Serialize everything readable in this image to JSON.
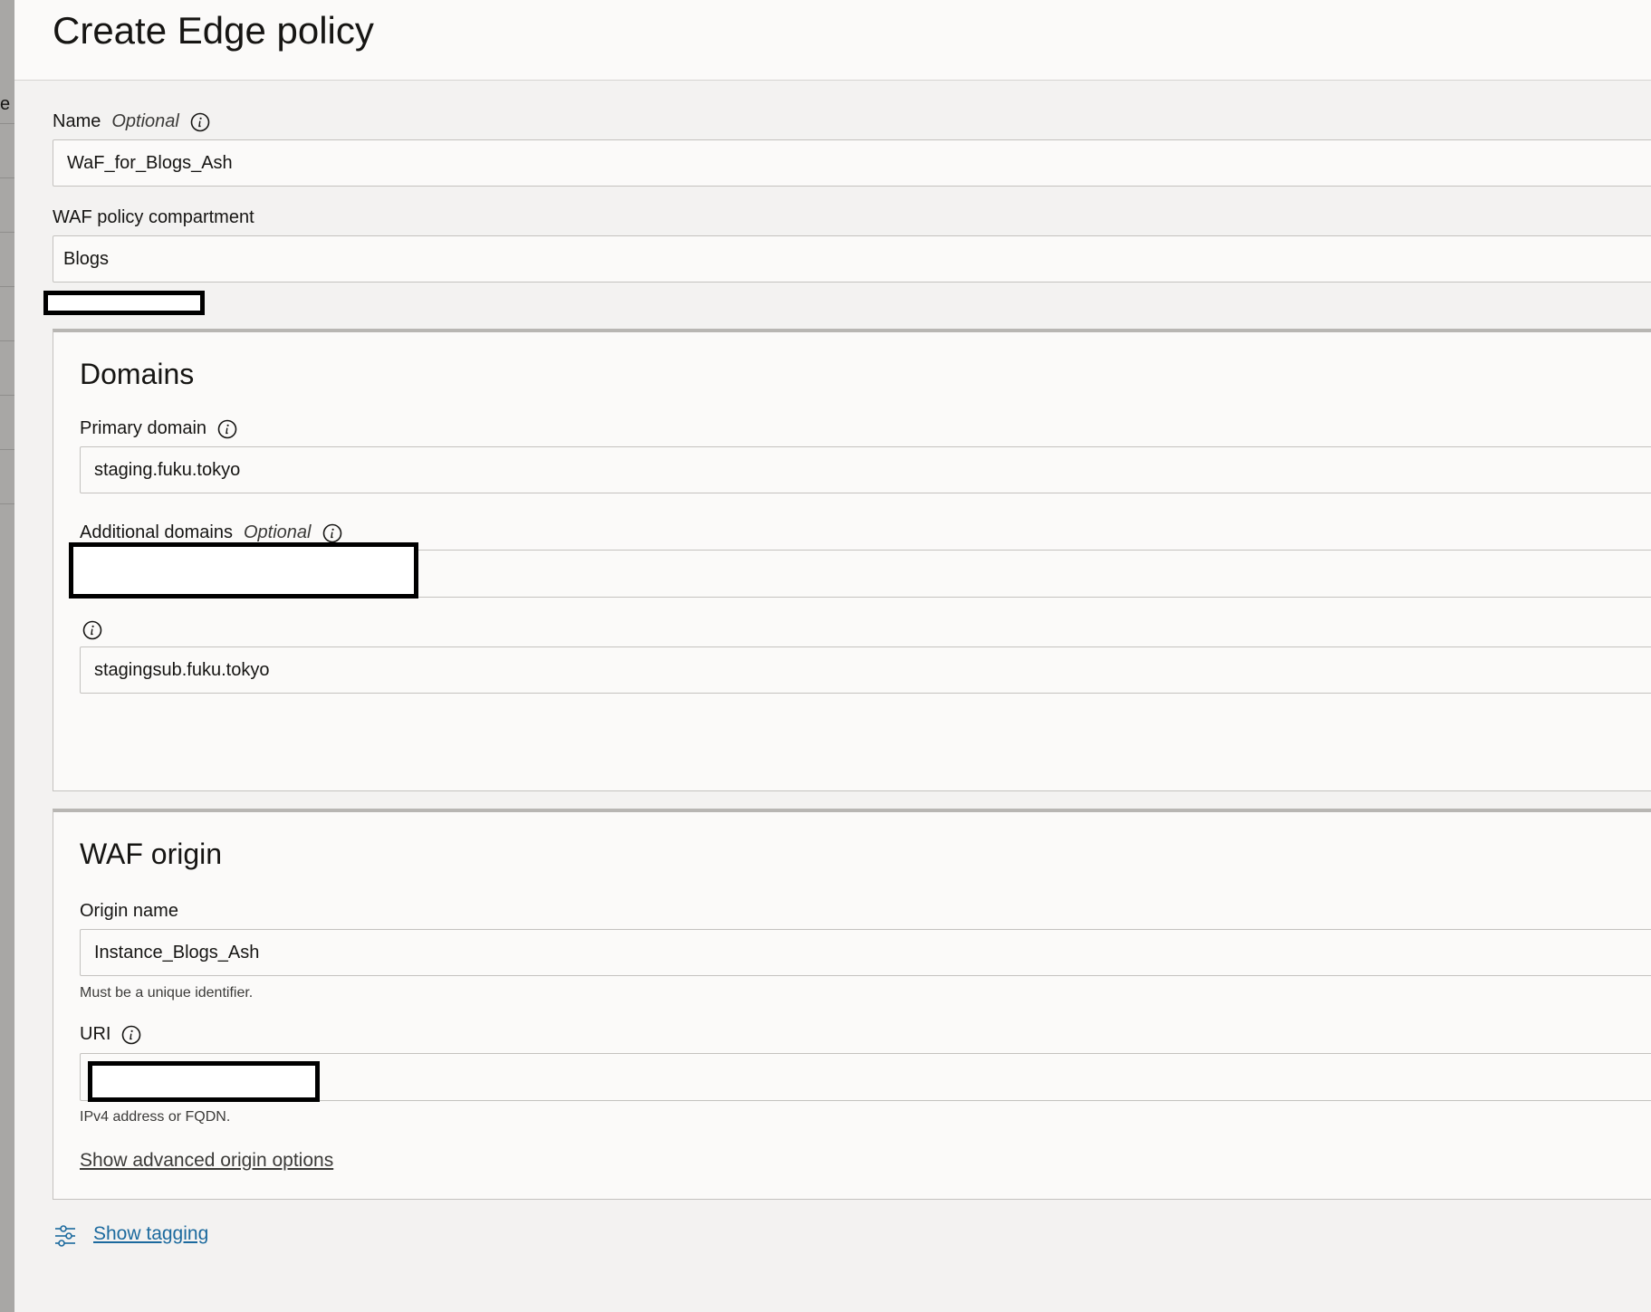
{
  "left_strip": {
    "partial_text": "e"
  },
  "header": {
    "title": "Create Edge policy"
  },
  "form": {
    "name": {
      "label": "Name",
      "optional": "Optional",
      "value": "WaF_for_Blogs_Ash"
    },
    "compartment": {
      "label": "WAF policy compartment",
      "value": "Blogs"
    }
  },
  "domains": {
    "title": "Domains",
    "primary": {
      "label": "Primary domain",
      "value": "staging.fuku.tokyo"
    },
    "additional": {
      "label": "Additional domains",
      "optional": "Optional",
      "value": "stagingsub.fuku.tokyo"
    }
  },
  "origin": {
    "title": "WAF origin",
    "name": {
      "label": "Origin name",
      "value": "Instance_Blogs_Ash",
      "helper": "Must be a unique identifier."
    },
    "uri": {
      "label": "URI",
      "helper": "IPv4 address or FQDN."
    },
    "advanced_link": "Show advanced origin options"
  },
  "tagging": {
    "link": "Show tagging",
    "icon": "sliders-icon"
  },
  "icons": {
    "info": "info-icon"
  }
}
